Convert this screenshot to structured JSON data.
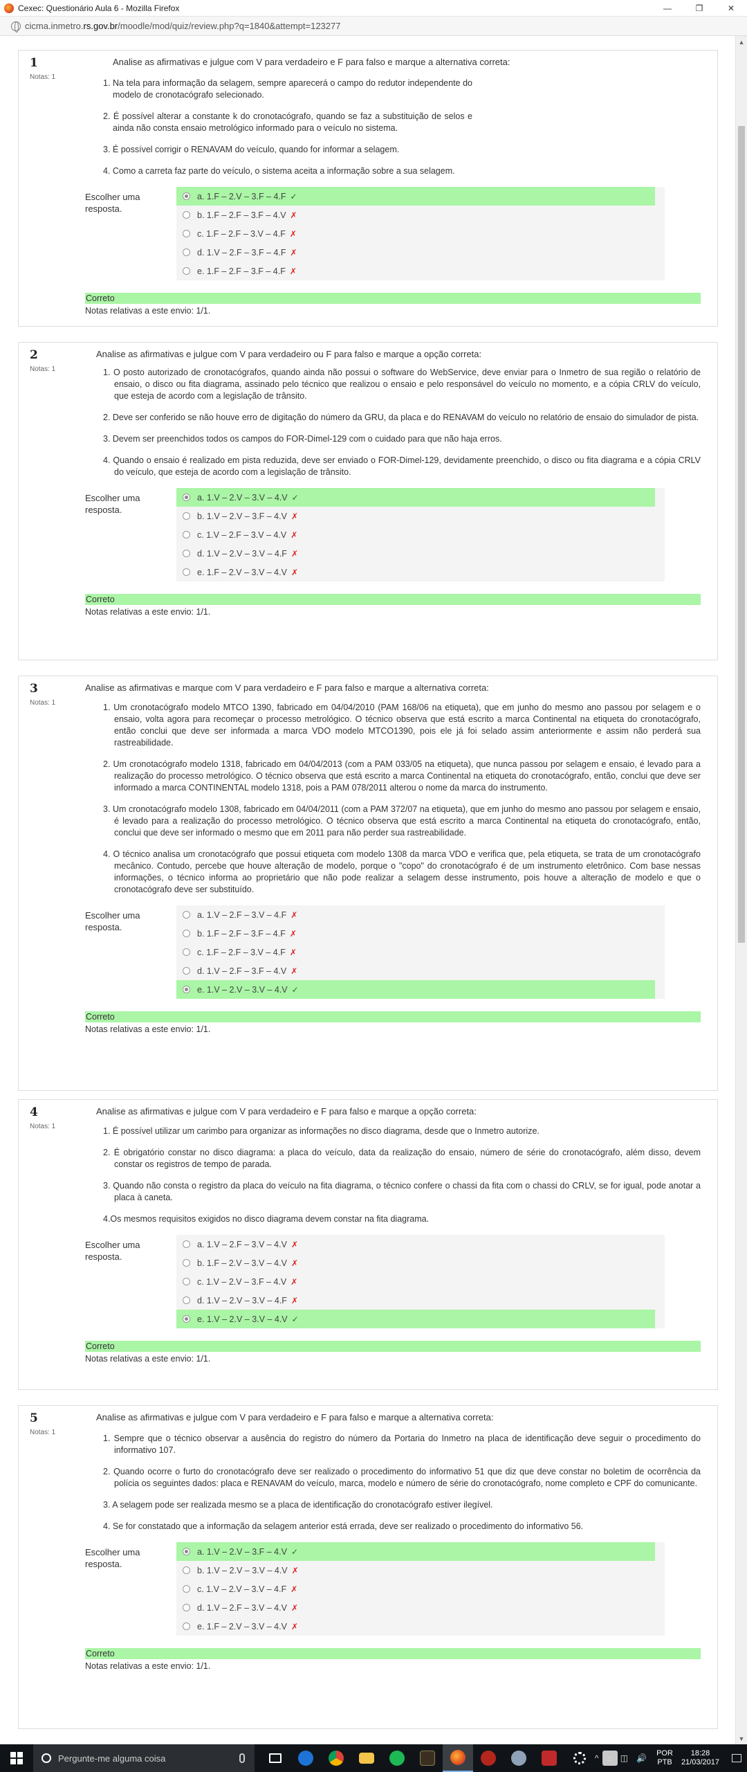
{
  "window": {
    "title": "Cexec: Questionário Aula 6 - Mozilla Firefox",
    "controls": [
      "—",
      "❐",
      "✕"
    ]
  },
  "browser": {
    "url_prefix": "cicma.inmetro.",
    "url_domain": "rs.gov.br",
    "url_path": "/moodle/mod/quiz/review.php?q=1840&attempt=123277"
  },
  "labels": {
    "prompt": "Escolher uma resposta.",
    "grade": "Notas: 1",
    "correct": "Correto",
    "marks": "Notas relativas a este envio: 1/1."
  },
  "questions": [
    {
      "number": "1",
      "text": "Analise as afirmativas e julgue com V para verdadeiro e F para falso e marque a alternativa correta:",
      "items": [
        "1. Na tela para informação da selagem, sempre aparecerá o campo do redutor independente do modelo de cronotacógrafo selecionado.",
        "2. É possível alterar a constante k do cronotacógrafo, quando se faz a substituição de selos e ainda não consta ensaio metrológico informado para o veículo no sistema.",
        "3. É possível corrigir o RENAVAM do veículo, quando for informar a selagem.",
        "4. Como a carreta faz parte do veículo, o sistema aceita a informação sobre a sua selagem."
      ],
      "options": [
        {
          "label": "a. 1.F – 2.V – 3.F – 4.F",
          "mark": "✓",
          "correct": true
        },
        {
          "label": "b. 1.F – 2.F – 3.F – 4.V",
          "mark": "✗",
          "correct": false
        },
        {
          "label": "c. 1.F – 2.F – 3.V – 4.F",
          "mark": "✗",
          "correct": false
        },
        {
          "label": "d. 1.V – 2.F – 3.F – 4.F",
          "mark": "✗",
          "correct": false
        },
        {
          "label": "e. 1.F – 2.F – 3.F – 4.F",
          "mark": "✗",
          "correct": false
        }
      ]
    },
    {
      "number": "2",
      "text": "Analise as afirmativas e julgue com V para verdadeiro ou F para falso e marque a opção correta:",
      "items": [
        "1. O posto autorizado de cronotacógrafos, quando ainda não possui o software do WebService, deve enviar para o Inmetro de sua região o relatório de ensaio, o disco ou fita diagrama, assinado pelo técnico que realizou o ensaio e pelo responsável do veículo no momento, e a cópia CRLV do veículo, que esteja de acordo com a legislação de trânsito.",
        "2. Deve ser conferido se não houve erro de digitação do número da GRU, da placa e do RENAVAM do veículo no relatório de ensaio do simulador de pista.",
        "3. Devem ser preenchidos todos os campos do FOR-Dimel-129 com o cuidado para que não haja erros.",
        "4. Quando o ensaio é realizado em pista reduzida, deve ser enviado o FOR-Dimel-129, devidamente preenchido, o disco ou fita diagrama e a cópia CRLV do veículo, que esteja de acordo com a legislação de trânsito."
      ],
      "options": [
        {
          "label": "a. 1.V – 2.V – 3.V – 4.V",
          "mark": "✓",
          "correct": true
        },
        {
          "label": "b. 1.V – 2.V – 3.F – 4.V",
          "mark": "✗",
          "correct": false
        },
        {
          "label": "c. 1.V – 2.F – 3.V – 4.V",
          "mark": "✗",
          "correct": false
        },
        {
          "label": "d. 1.V – 2.V – 3.V – 4.F",
          "mark": "✗",
          "correct": false
        },
        {
          "label": "e. 1.F – 2.V – 3.V – 4.V",
          "mark": "✗",
          "correct": false
        }
      ]
    },
    {
      "number": "3",
      "text": "Analise as afirmativas e marque com V para verdadeiro e F para falso e marque a alternativa correta:",
      "items": [
        "1. Um cronotacógrafo modelo MTCO 1390, fabricado em 04/04/2010 (PAM 168/06 na etiqueta), que em junho do mesmo ano passou por selagem e o ensaio, volta agora para recomeçar o processo metrológico. O técnico observa que está escrito a marca Continental na etiqueta do cronotacógrafo, então conclui que deve ser informada a marca VDO modelo MTCO1390, pois ele já foi selado assim anteriormente e assim não perderá sua rastreabilidade.",
        "2. Um cronotacógrafo modelo 1318, fabricado em 04/04/2013 (com a PAM 033/05 na etiqueta), que nunca passou por selagem e ensaio, é levado para a realização do processo metrológico. O técnico observa que está escrito a marca Continental na etiqueta do cronotacógrafo, então, conclui que deve ser informado a marca CONTINENTAL modelo 1318, pois a PAM 078/2011 alterou o nome da marca do instrumento.",
        "3. Um cronotacógrafo modelo 1308, fabricado em 04/04/2011 (com a PAM 372/07 na etiqueta), que em junho do mesmo ano passou por selagem e ensaio, é levado para a realização do processo metrológico. O técnico observa que está escrito a marca Continental na etiqueta do cronotacógrafo, então, conclui que deve ser informado o mesmo que em 2011 para não perder sua rastreabilidade.",
        "4. O técnico analisa um cronotacógrafo que possui etiqueta com modelo 1308 da marca VDO e verifica que, pela etiqueta, se trata de um cronotacógrafo mecânico. Contudo, percebe que houve alteração de modelo, porque o \"copo\" do cronotacógrafo é de um instrumento eletrônico. Com base nessas informações, o técnico informa ao proprietário que não pode realizar a selagem desse instrumento, pois houve a alteração de modelo e que o cronotacógrafo deve ser substituído."
      ],
      "options": [
        {
          "label": "a. 1.V – 2.F – 3.V – 4.F",
          "mark": "✗",
          "correct": false
        },
        {
          "label": "b. 1.F – 2.F – 3.F – 4.F",
          "mark": "✗",
          "correct": false
        },
        {
          "label": "c. 1.F – 2.F – 3.V – 4.F",
          "mark": "✗",
          "correct": false
        },
        {
          "label": "d. 1.V – 2.F – 3.F – 4.V",
          "mark": "✗",
          "correct": false
        },
        {
          "label": "e. 1.V – 2.V – 3.V – 4.V",
          "mark": "✓",
          "correct": true
        }
      ]
    },
    {
      "number": "4",
      "text": "Analise as afirmativas e julgue com V para verdadeiro e F para falso e marque a opção correta:",
      "items": [
        "1. É possível utilizar um carimbo para organizar as informações no disco diagrama, desde que o Inmetro autorize.",
        "2. É obrigatório constar no disco diagrama: a placa do veículo, data da realização do ensaio, número de série do cronotacógrafo, além disso, devem constar os registros de tempo de parada.",
        "3. Quando não consta o registro da placa do veículo na fita diagrama, o técnico confere o chassi da fita com o chassi do CRLV, se for igual, pode anotar a placa à caneta.",
        "4.Os mesmos requisitos exigidos no disco diagrama devem constar na fita diagrama."
      ],
      "options": [
        {
          "label": "a. 1.V – 2.F – 3.V – 4.V",
          "mark": "✗",
          "correct": false
        },
        {
          "label": "b. 1.F – 2.V – 3.V – 4.V",
          "mark": "✗",
          "correct": false
        },
        {
          "label": "c. 1.V – 2.V – 3.F – 4.V",
          "mark": "✗",
          "correct": false
        },
        {
          "label": "d. 1.V – 2.V – 3.V – 4.F",
          "mark": "✗",
          "correct": false
        },
        {
          "label": "e. 1.V – 2.V – 3.V – 4.V",
          "mark": "✓",
          "correct": true
        }
      ]
    },
    {
      "number": "5",
      "text": "Analise as afirmativas e julgue com V para verdadeiro e F para falso e marque a alternativa correta:",
      "items": [
        "1. Sempre que o técnico observar a ausência do registro do número da Portaria do Inmetro na placa de identificação deve seguir o procedimento do informativo 107.",
        "2. Quando ocorre o furto do cronotacógrafo deve ser realizado o procedimento do informativo 51 que diz que deve constar no boletim de ocorrência da polícia os seguintes dados: placa e RENAVAM do veículo, marca, modelo e número de série do cronotacógrafo, nome completo e CPF do comunicante.",
        "3. A selagem pode ser realizada mesmo se a placa de identificação do cronotacógrafo estiver ilegível.",
        "4. Se for constatado que a informação da selagem anterior está errada, deve ser realizado o procedimento do informativo 56."
      ],
      "options": [
        {
          "label": "a. 1.V – 2.V – 3.F – 4.V",
          "mark": "✓",
          "correct": true
        },
        {
          "label": "b. 1.V – 2.V – 3.V – 4.V",
          "mark": "✗",
          "correct": false
        },
        {
          "label": "c. 1.V – 2.V – 3.V – 4.F",
          "mark": "✗",
          "correct": false
        },
        {
          "label": "d. 1.V – 2.F – 3.V – 4.V",
          "mark": "✗",
          "correct": false
        },
        {
          "label": "e. 1.F – 2.V – 3.V – 4.V",
          "mark": "✗",
          "correct": false
        }
      ]
    }
  ],
  "taskbar": {
    "search_placeholder": "Pergunte-me alguma coisa",
    "lang_top": "POR",
    "lang_bottom": "PTB",
    "time": "18:28",
    "date": "21/03/2017",
    "tray_symbols": [
      "^",
      "⌂",
      "◫",
      "🔊"
    ]
  },
  "colors": {
    "correct_bg": "#aaf5a6",
    "tick": "#1a7a12",
    "cross": "#d92222"
  }
}
